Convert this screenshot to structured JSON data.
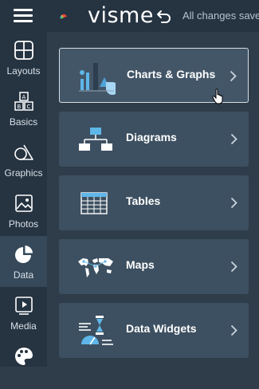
{
  "header": {
    "logo_text": "visme",
    "save_status": "All changes saved"
  },
  "sidebar": {
    "items": [
      {
        "label": "Layouts",
        "icon": "layouts-icon"
      },
      {
        "label": "Basics",
        "icon": "basics-icon"
      },
      {
        "label": "Graphics",
        "icon": "graphics-icon"
      },
      {
        "label": "Photos",
        "icon": "photos-icon"
      },
      {
        "label": "Data",
        "icon": "data-pie-icon",
        "active": true
      },
      {
        "label": "Media",
        "icon": "media-icon"
      },
      {
        "label": "",
        "icon": "palette-icon"
      }
    ]
  },
  "categories": [
    {
      "label": "Charts & Graphs",
      "icon": "charts-graphs-icon",
      "hovered": true
    },
    {
      "label": "Diagrams",
      "icon": "diagram-icon"
    },
    {
      "label": "Tables",
      "icon": "table-icon"
    },
    {
      "label": "Maps",
      "icon": "world-map-icon"
    },
    {
      "label": "Data Widgets",
      "icon": "data-widgets-icon"
    }
  ],
  "colors": {
    "accent_blue": "#4fb0e6",
    "sidebar_bg": "#263341",
    "panel_bg": "#2f3d4a",
    "card_bg": "#3d5061"
  }
}
